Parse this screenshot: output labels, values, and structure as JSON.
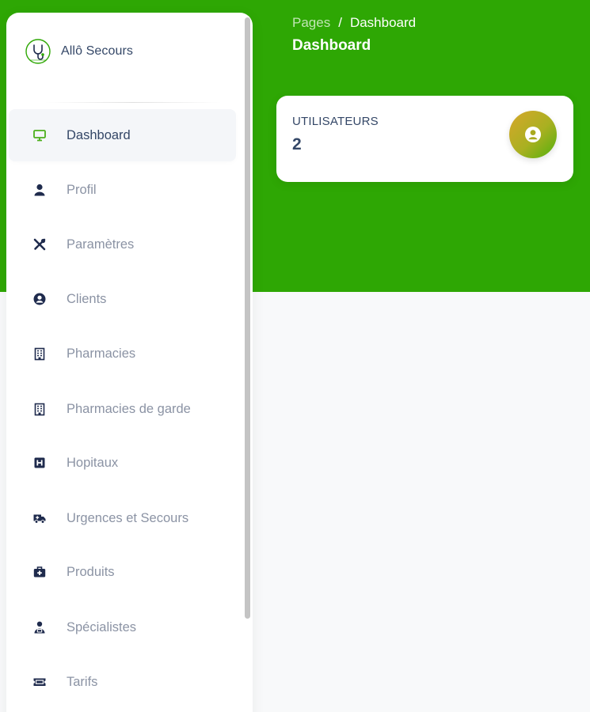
{
  "sidebar": {
    "brand": {
      "name": "Allô Secours",
      "logo_icon": "stethoscope-logo-icon"
    },
    "items": [
      {
        "label": "Dashboard",
        "icon": "monitor-icon",
        "active": true
      },
      {
        "label": "Profil",
        "icon": "user-icon",
        "active": false
      },
      {
        "label": "Paramètres",
        "icon": "tools-icon",
        "active": false
      },
      {
        "label": "Clients",
        "icon": "user-circle-icon",
        "active": false
      },
      {
        "label": "Pharmacies",
        "icon": "building-icon",
        "active": false
      },
      {
        "label": "Pharmacies de garde",
        "icon": "building-icon",
        "active": false
      },
      {
        "label": "Hopitaux",
        "icon": "hospital-icon",
        "active": false
      },
      {
        "label": "Urgences et Secours",
        "icon": "ambulance-icon",
        "active": false
      },
      {
        "label": "Produits",
        "icon": "medkit-icon",
        "active": false
      },
      {
        "label": "Spécialistes",
        "icon": "doctor-icon",
        "active": false
      },
      {
        "label": "Tarifs",
        "icon": "ticket-icon",
        "active": false
      }
    ]
  },
  "header": {
    "breadcrumb": {
      "parent": "Pages",
      "separator": "/",
      "current": "Dashboard"
    },
    "title": "Dashboard"
  },
  "stats": {
    "users": {
      "label": "UTILISATEURS",
      "value": "2",
      "icon": "user-circle-icon"
    }
  },
  "colors": {
    "accent_green": "#2ea704",
    "text_dark": "#344767",
    "text_muted": "#8b93a4",
    "icon_dark": "#1f2b4d",
    "active_icon": "#4caf1c"
  }
}
